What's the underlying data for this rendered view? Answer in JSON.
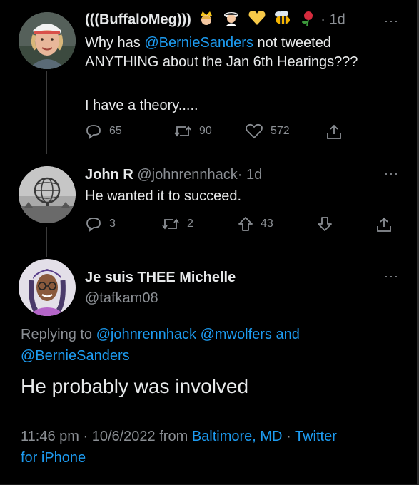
{
  "tweet1": {
    "display_name": "(((BuffaloMeg)))",
    "dot": "·",
    "time": "1d",
    "more": "···",
    "text_line1_pre": "Why has ",
    "mention": "@BernieSanders",
    "text_line1_post": " not tweeted",
    "text_line2": "ANYTHING about the Jan 6th Hearings???",
    "text_line3": "I have a theory.....",
    "replies": "65",
    "retweets": "90",
    "likes": "572",
    "emojis": [
      "princess-emoji",
      "detective-emoji",
      "yellow-heart-emoji",
      "bee-emoji",
      "rose-emoji"
    ]
  },
  "tweet2": {
    "display_name": "John R",
    "handle": "@johnrennhack",
    "dot": "·",
    "time": "1d",
    "more": "···",
    "text": "He wanted it to succeed.",
    "replies": "3",
    "retweets": "2",
    "upvotes": "43"
  },
  "tweet3": {
    "display_name": "Je suis THEE Michelle",
    "handle": "@tafkam08",
    "more": "···",
    "replying_to_label": "Replying to",
    "replying_mention1": "@johnrennhack",
    "replying_mention2": "@mwolfers",
    "replying_and": "and",
    "replying_mention3": "@BernieSanders",
    "text": "He probably was involved",
    "meta_time": "11:46 pm",
    "meta_dot1": "·",
    "meta_date": "10/6/2022",
    "meta_from": "from",
    "meta_location": "Baltimore, MD",
    "meta_dot2": "·",
    "meta_source_line1": "Twitter",
    "meta_source_line2": "for iPhone"
  },
  "colors": {
    "background": "#000000",
    "text": "#e7e9ea",
    "muted": "#8b8f94",
    "link": "#1d9bf0"
  }
}
